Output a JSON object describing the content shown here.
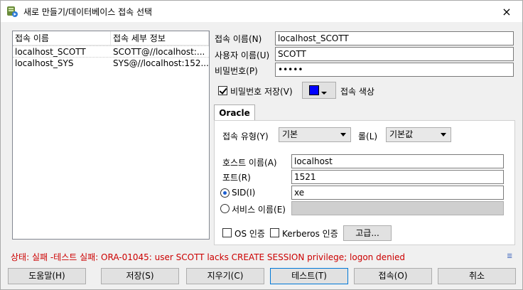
{
  "window": {
    "title": "새로 만들기/데이터베이스 접속 선택",
    "close_icon": "×"
  },
  "list": {
    "headers": [
      "접속 이름",
      "접속 세부 정보"
    ],
    "rows": [
      {
        "name": "localhost_SCOTT",
        "details": "SCOTT@//localhost:..."
      },
      {
        "name": "localhost_SYS",
        "details": "SYS@//localhost:152..."
      }
    ]
  },
  "form": {
    "conn_name_label": "접속 이름(N)",
    "conn_name_value": "localhost_SCOTT",
    "user_label": "사용자 이름(U)",
    "user_value": "SCOTT",
    "password_label": "비밀번호(P)",
    "password_value": "•••••",
    "save_pw_label": "비밀번호 저장(V)",
    "conn_color_label": "접속 색상",
    "conn_color": "#0000ff"
  },
  "tab": {
    "oracle_label": "Oracle"
  },
  "oracle": {
    "conn_type_label": "접속 유형(Y)",
    "conn_type_value": "기본",
    "role_label": "롤(L)",
    "role_value": "기본값",
    "host_label": "호스트 이름(A)",
    "host_value": "localhost",
    "port_label": "포트(R)",
    "port_value": "1521",
    "sid_label": "SID(I)",
    "sid_value": "xe",
    "service_label": "서비스 이름(E)",
    "service_value": "",
    "os_auth_label": "OS 인증",
    "kerberos_label": "Kerberos 인증",
    "advanced_label": "고급..."
  },
  "status": {
    "text": "상태: 실패 -테스트 실패: ORA-01045: user SCOTT lacks CREATE SESSION privilege; logon denied",
    "color": "#cc0000"
  },
  "buttons": {
    "help": "도움말(H)",
    "save": "저장(S)",
    "clear": "지우기(C)",
    "test": "테스트(T)",
    "connect": "접속(O)",
    "cancel": "취소"
  }
}
